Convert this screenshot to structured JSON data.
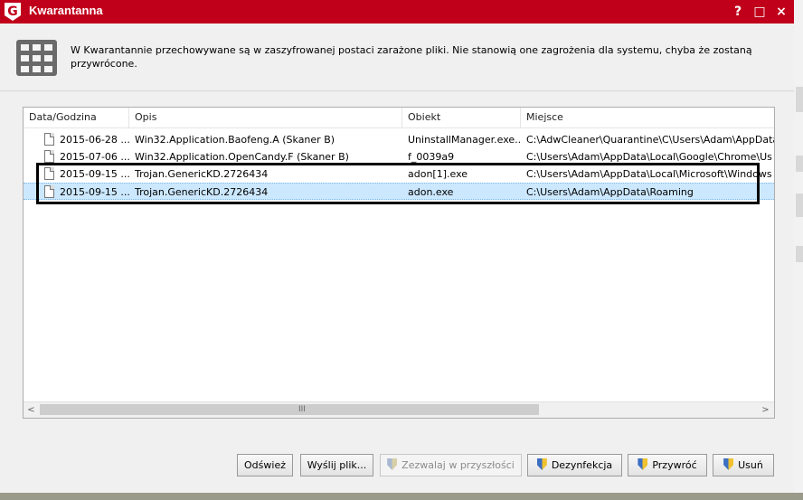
{
  "window": {
    "title": "Kwarantanna",
    "logo_letter": "G",
    "help_glyph": "?",
    "maximize_glyph": "□",
    "close_glyph": "×"
  },
  "info": {
    "text": "W Kwarantannie przechowywane są w zaszyfrowanej postaci zarażone pliki. Nie stanowią one zagrożenia dla systemu, chyba że zostaną przywrócone.",
    "icon": "quarantine-grid-icon"
  },
  "list": {
    "columns": [
      "Data/Godzina",
      "Opis",
      "Obiekt",
      "Miejsce"
    ],
    "rows": [
      {
        "date": "2015-06-28 ...",
        "desc": "Win32.Application.Baofeng.A (Skaner B)",
        "object": "UninstallManager.exe...",
        "location": "C:\\AdwCleaner\\Quarantine\\C\\Users\\Adam\\AppData",
        "selected": false
      },
      {
        "date": "2015-07-06 ...",
        "desc": "Win32.Application.OpenCandy.F (Skaner B)",
        "object": "f_0039a9",
        "location": "C:\\Users\\Adam\\AppData\\Local\\Google\\Chrome\\Us",
        "selected": false
      },
      {
        "date": "2015-09-15 ...",
        "desc": "Trojan.GenericKD.2726434",
        "object": "adon[1].exe",
        "location": "C:\\Users\\Adam\\AppData\\Local\\Microsoft\\Windows",
        "selected": false
      },
      {
        "date": "2015-09-15 ...",
        "desc": "Trojan.GenericKD.2726434",
        "object": "adon.exe",
        "location": "C:\\Users\\Adam\\AppData\\Roaming",
        "selected": true
      }
    ],
    "scroll_left": "<",
    "scroll_right": ">",
    "scroll_grip": "III"
  },
  "buttons": {
    "refresh": "Odśwież",
    "send_file": "Wyślij plik...",
    "allow_future": "Zezwalaj w przyszłości",
    "disinfect": "Dezynfekcja",
    "restore": "Przywróć",
    "delete": "Usuń"
  },
  "colors": {
    "titlebar": "#c0001a",
    "selection": "#cce8ff"
  }
}
